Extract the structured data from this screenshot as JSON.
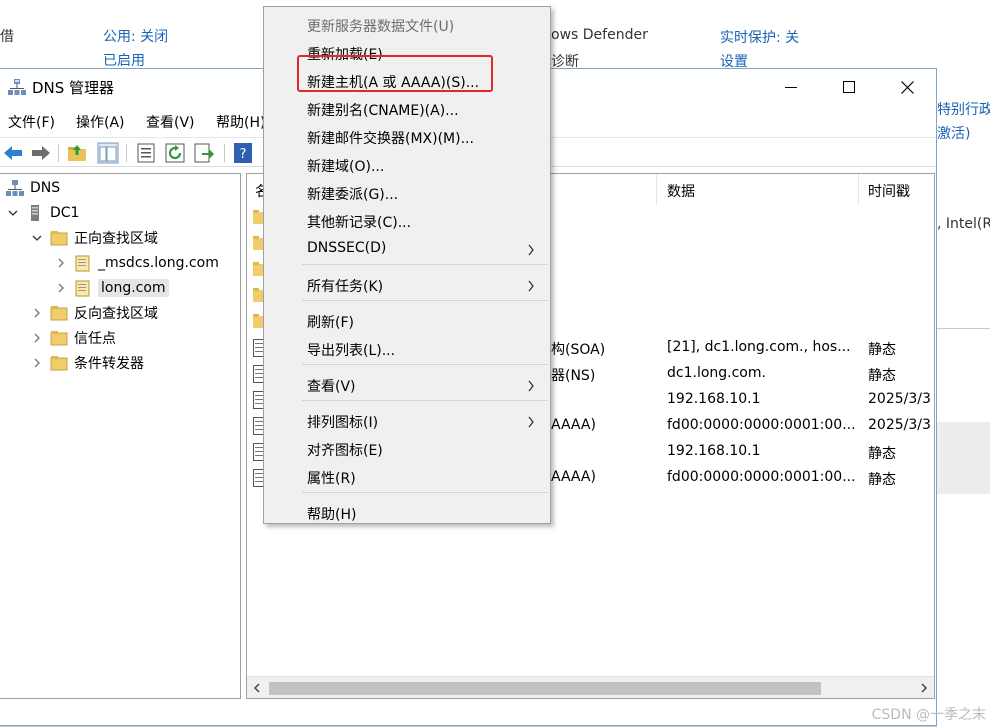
{
  "background": {
    "left_text": "借",
    "public_label": "公用: 关闭",
    "enabled_label": "已启用",
    "defender_label": "ows Defender",
    "diagnostics_label": "诊断",
    "realtime_label": "实时保护: 关",
    "settings_label": "设置",
    "right_text_1": "特别行政",
    "right_text_2": "激活)",
    "right_text_3": ", Intel(R"
  },
  "window": {
    "title": "DNS 管理器",
    "menus": [
      "文件(F)",
      "操作(A)",
      "查看(V)",
      "帮助(H)"
    ]
  },
  "tree": {
    "root": "DNS",
    "server": "DC1",
    "forward_zones": "正向查找区域",
    "msdcs_zone": "_msdcs.long.com",
    "long_zone": "long.com",
    "reverse_zones": "反向查找区域",
    "trust_points": "信任点",
    "conditional_forwarders": "条件转发器"
  },
  "list": {
    "headers": [
      "名",
      "数据",
      "时间戳"
    ],
    "rows": [
      {
        "type": "",
        "data": "",
        "time": "",
        "folder": true
      },
      {
        "type": "",
        "data": "",
        "time": "",
        "folder": true
      },
      {
        "type": "",
        "data": "",
        "time": "",
        "folder": true
      },
      {
        "type": "",
        "data": "",
        "time": "",
        "folder": true
      },
      {
        "type": "",
        "data": "",
        "time": "",
        "folder": true
      },
      {
        "type": "构(SOA)",
        "data": "[21], dc1.long.com., hos...",
        "time": "静态"
      },
      {
        "type": "器(NS)",
        "data": "dc1.long.com.",
        "time": "静态"
      },
      {
        "type": "",
        "data": "192.168.10.1",
        "time": "2025/3/3"
      },
      {
        "type": "AAAA)",
        "data": "fd00:0000:0000:0001:00...",
        "time": "2025/3/3"
      },
      {
        "type": "",
        "data": "192.168.10.1",
        "time": "静态"
      },
      {
        "type": "AAAA)",
        "data": "fd00:0000:0000:0001:00...",
        "time": "静态"
      }
    ]
  },
  "context_menu": {
    "items": [
      {
        "label": "更新服务器数据文件(U)",
        "disabled": true
      },
      {
        "label": "重新加载(E)"
      },
      {
        "label": "新建主机(A 或 AAAA)(S)...",
        "highlighted": true
      },
      {
        "label": "新建别名(CNAME)(A)..."
      },
      {
        "label": "新建邮件交换器(MX)(M)..."
      },
      {
        "label": "新建域(O)..."
      },
      {
        "label": "新建委派(G)..."
      },
      {
        "label": "其他新记录(C)..."
      },
      {
        "label": "DNSSEC(D)",
        "submenu": true
      },
      {
        "label": "所有任务(K)",
        "submenu": true
      },
      {
        "label": "刷新(F)"
      },
      {
        "label": "导出列表(L)..."
      },
      {
        "label": "查看(V)",
        "submenu": true
      },
      {
        "label": "排列图标(I)",
        "submenu": true
      },
      {
        "label": "对齐图标(E)"
      },
      {
        "label": "属性(R)"
      },
      {
        "label": "帮助(H)"
      }
    ],
    "highlight_color": "#e0282d"
  },
  "watermark": "CSDN @一季之末"
}
